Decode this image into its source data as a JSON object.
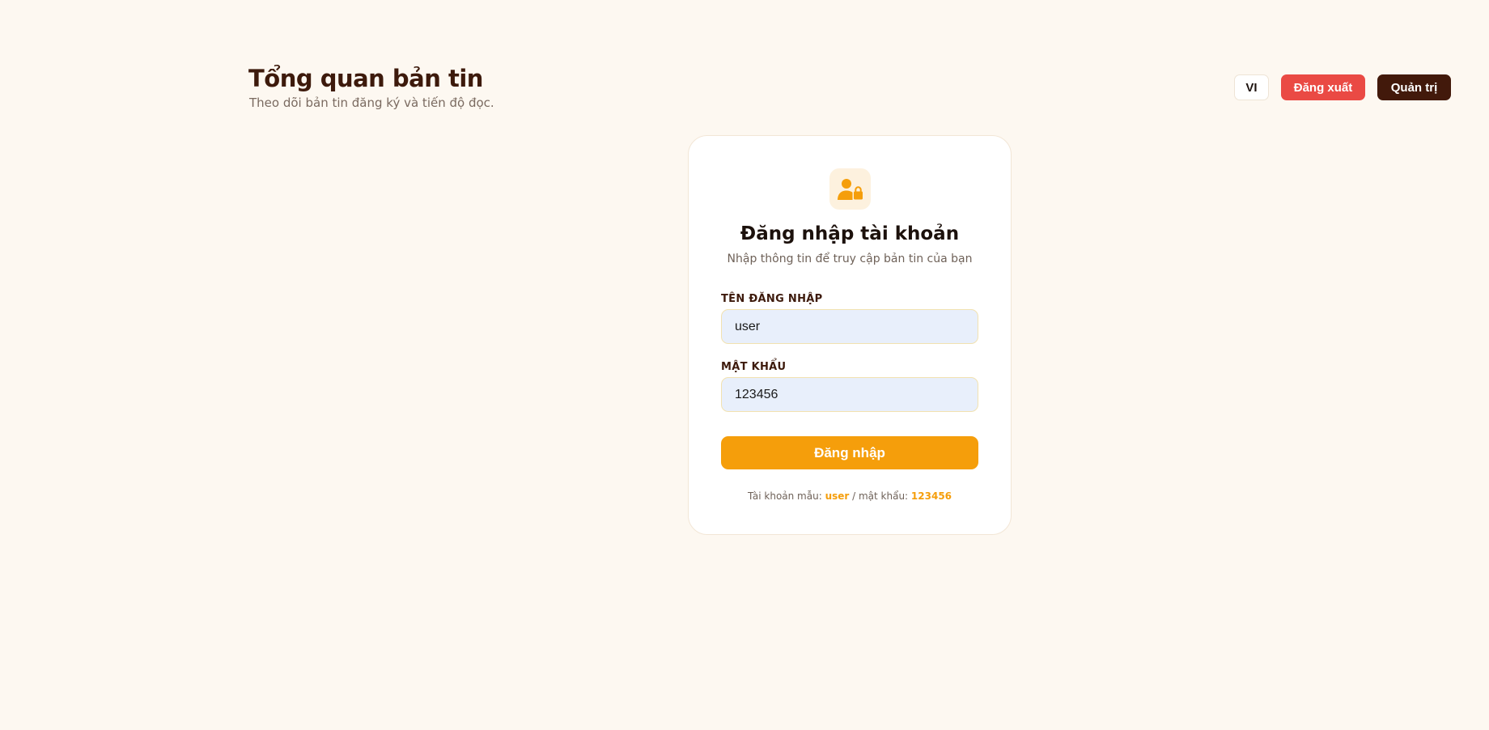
{
  "header": {
    "title": "Tổng quan bản tin",
    "subtitle": "Theo dõi bản tin đăng ký và tiến độ đọc."
  },
  "topbar": {
    "language_label": "VI",
    "logout_label": "Đăng xuất",
    "admin_label": "Quản trị"
  },
  "login": {
    "icon": "user-lock-icon",
    "title": "Đăng nhập tài khoản",
    "subtitle": "Nhập thông tin để truy cập bản tin của bạn",
    "username_label": "TÊN ĐĂNG NHẬP",
    "username_value": "user",
    "password_label": "MẬT KHẨU",
    "password_value": "123456",
    "submit_label": "Đăng nhập",
    "hint_prefix": "Tài khoản mẫu: ",
    "hint_user": "user",
    "hint_separator": " / mật khẩu: ",
    "hint_password": "123456"
  },
  "colors": {
    "background": "#fdf8f1",
    "primary_dark": "#42190b",
    "accent": "#f59e0b",
    "danger": "#ea4a44"
  }
}
